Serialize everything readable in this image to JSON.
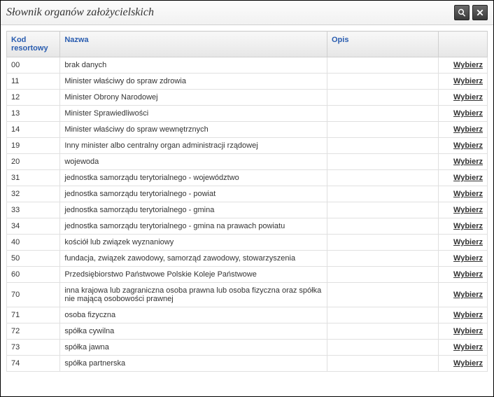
{
  "window": {
    "title": "Słownik organów założycielskich"
  },
  "columns": {
    "code": "Kod resortowy",
    "name": "Nazwa",
    "opis": "Opis"
  },
  "action_label": "Wybierz",
  "rows": [
    {
      "code": "00",
      "name": "brak danych",
      "opis": ""
    },
    {
      "code": "11",
      "name": "Minister właściwy do spraw zdrowia",
      "opis": ""
    },
    {
      "code": "12",
      "name": "Minister Obrony Narodowej",
      "opis": ""
    },
    {
      "code": "13",
      "name": "Minister Sprawiedliwości",
      "opis": ""
    },
    {
      "code": "14",
      "name": "Minister właściwy do spraw wewnętrznych",
      "opis": ""
    },
    {
      "code": "19",
      "name": "Inny minister albo centralny organ administracji rządowej",
      "opis": ""
    },
    {
      "code": "20",
      "name": "wojewoda",
      "opis": ""
    },
    {
      "code": "31",
      "name": "jednostka samorządu terytorialnego - województwo",
      "opis": ""
    },
    {
      "code": "32",
      "name": "jednostka samorządu terytorialnego - powiat",
      "opis": ""
    },
    {
      "code": "33",
      "name": "jednostka samorządu terytorialnego - gmina",
      "opis": ""
    },
    {
      "code": "34",
      "name": "jednostka samorządu terytorialnego - gmina na prawach powiatu",
      "opis": ""
    },
    {
      "code": "40",
      "name": "kościół lub związek wyznaniowy",
      "opis": ""
    },
    {
      "code": "50",
      "name": "fundacja, związek zawodowy, samorząd zawodowy, stowarzyszenia",
      "opis": ""
    },
    {
      "code": "60",
      "name": "Przedsiębiorstwo Państwowe Polskie Koleje Państwowe",
      "opis": ""
    },
    {
      "code": "70",
      "name": "inna krajowa lub zagraniczna osoba prawna lub osoba fizyczna oraz spółka nie mającą osobowości prawnej",
      "opis": ""
    },
    {
      "code": "71",
      "name": "osoba fizyczna",
      "opis": ""
    },
    {
      "code": "72",
      "name": "spółka cywilna",
      "opis": ""
    },
    {
      "code": "73",
      "name": "spółka jawna",
      "opis": ""
    },
    {
      "code": "74",
      "name": "spółka partnerska",
      "opis": ""
    }
  ]
}
